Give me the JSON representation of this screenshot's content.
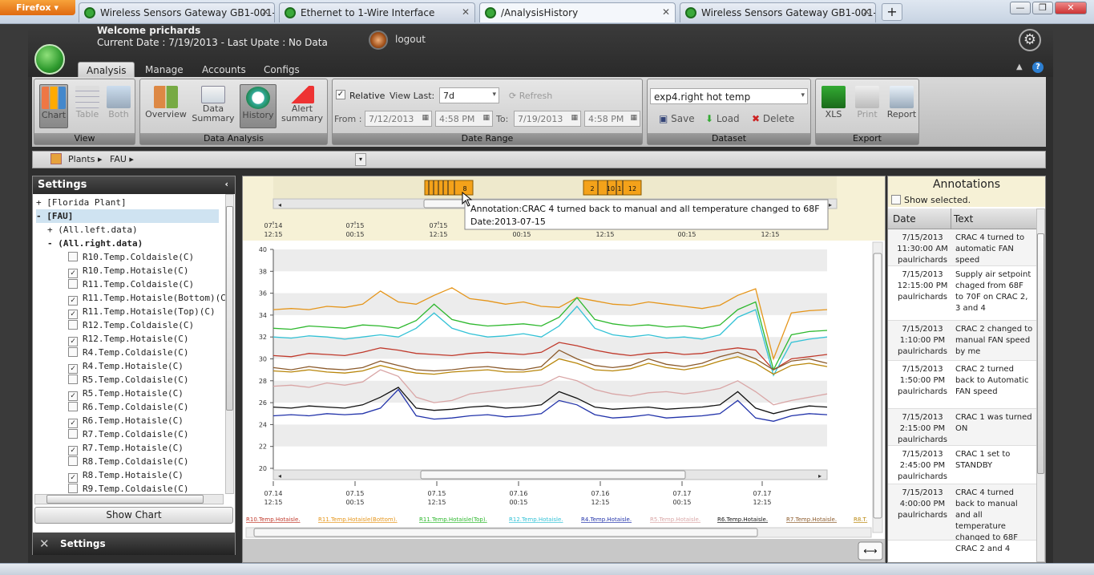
{
  "browser": {
    "app_button": "Firefox",
    "tabs": [
      {
        "title": "Wireless Sensors Gateway GB1-001-20..."
      },
      {
        "title": "Ethernet to 1-Wire Interface"
      },
      {
        "title": "/AnalysisHistory"
      },
      {
        "title": "Wireless Sensors Gateway GB1-001-20..."
      }
    ],
    "new_tab": "+",
    "win_min": "—",
    "win_max": "❐",
    "win_close": "✕"
  },
  "header": {
    "welcome": "Welcome prichards",
    "current_date": "Current Date : 7/19/2013 - Last Upate : No Data",
    "logout": "logout",
    "gear": "⚙"
  },
  "main_tabs": [
    "Analysis",
    "Manage",
    "Accounts",
    "Configs"
  ],
  "ribbon": {
    "view": {
      "label": "View",
      "buttons": [
        "Chart",
        "Table",
        "Both"
      ]
    },
    "data_analysis": {
      "label": "Data Analysis",
      "buttons": [
        "Overview",
        "Data\nSummary",
        "History",
        "Alert\nsummary"
      ]
    },
    "date_range": {
      "label": "Date Range",
      "relative": "Relative",
      "view_last_label": "View Last:",
      "view_last": "7d",
      "refresh": "Refresh",
      "from_label": "From :",
      "from_date": "7/12/2013",
      "from_time": "4:58 PM",
      "to_label": "To:",
      "to_date": "7/19/2013",
      "to_time": "4:58 PM"
    },
    "dataset": {
      "label": "Dataset",
      "selected": "exp4.right hot temp",
      "save": "Save",
      "load": "Load",
      "delete": "Delete"
    },
    "export": {
      "label": "Export",
      "buttons": [
        "XLS",
        "Print",
        "Report"
      ]
    }
  },
  "breadcrumb": [
    "Plants",
    "FAU"
  ],
  "settings": {
    "title": "Settings",
    "tree": [
      {
        "t": "+ [Florida Plant]",
        "i": 0,
        "kind": "node"
      },
      {
        "t": "- [FAU]",
        "i": 0,
        "kind": "sel"
      },
      {
        "t": "+ (All.left.data)",
        "i": 1,
        "kind": "node"
      },
      {
        "t": "- (All.right.data)",
        "i": 1,
        "kind": "bold"
      },
      {
        "t": "R10.Temp.Coldaisle(C)",
        "c": false
      },
      {
        "t": "R10.Temp.Hotaisle(C)",
        "c": true
      },
      {
        "t": "R11.Temp.Coldaisle(C)",
        "c": false
      },
      {
        "t": "R11.Temp.Hotaisle(Bottom)(C)",
        "c": true
      },
      {
        "t": "R11.Temp.Hotaisle(Top)(C)",
        "c": true
      },
      {
        "t": "R12.Temp.Coldaisle(C)",
        "c": false
      },
      {
        "t": "R12.Temp.Hotaisle(C)",
        "c": true
      },
      {
        "t": "R4.Temp.Coldaisle(C)",
        "c": false
      },
      {
        "t": "R4.Temp.Hotaisle(C)",
        "c": true
      },
      {
        "t": "R5.Temp.Coldaisle(C)",
        "c": false
      },
      {
        "t": "R5.Temp.Hotaisle(C)",
        "c": true
      },
      {
        "t": "R6.Temp.Coldaisle(C)",
        "c": false
      },
      {
        "t": "R6.Temp.Hotaisle(C)",
        "c": true
      },
      {
        "t": "R7.Temp.Coldaisle(C)",
        "c": false
      },
      {
        "t": "R7.Temp.Hotaisle(C)",
        "c": true
      },
      {
        "t": "R8.Temp.Coldaisle(C)",
        "c": false
      },
      {
        "t": "R8.Temp.Hotaisle(C)",
        "c": true
      },
      {
        "t": "R9.Temp.Coldaisle(C)",
        "c": false
      }
    ],
    "show_chart": "Show Chart",
    "footer": "Settings"
  },
  "chart_data": {
    "type": "line",
    "tooltip": {
      "line1": "Annotation:CRAC 4 turned back to manual and all temperature changed to 68F",
      "line2": "Date:2013-07-15"
    },
    "markers": [
      "8",
      "2",
      "10",
      "1",
      "12"
    ],
    "nav_ticks": [
      [
        "07.14",
        "12:15"
      ],
      [
        "07.15",
        "00:15"
      ],
      [
        "07.15",
        "12:15"
      ],
      [
        "",
        "00:15"
      ],
      [
        "",
        "12:15"
      ],
      [
        "",
        "00:15"
      ],
      [
        "",
        "12:15"
      ]
    ],
    "x_ticks": [
      [
        "07.14",
        "12:15"
      ],
      [
        "07.15",
        "00:15"
      ],
      [
        "07.15",
        "12:15"
      ],
      [
        "07.16",
        "00:15"
      ],
      [
        "07.16",
        "12:15"
      ],
      [
        "07.17",
        "00:15"
      ],
      [
        "07.17",
        "12:15"
      ]
    ],
    "ylim": [
      20,
      40
    ],
    "y_ticks": [
      20,
      22,
      24,
      26,
      28,
      30,
      32,
      34,
      36,
      38,
      40
    ],
    "series": [
      {
        "name": "R10.Temp.Hotaisle",
        "color": "#c0392b",
        "values": [
          30.3,
          30.2,
          30.5,
          30.4,
          30.3,
          30.6,
          31.0,
          30.8,
          30.5,
          30.4,
          30.3,
          30.5,
          30.6,
          30.5,
          30.4,
          30.6,
          31.5,
          31.2,
          30.8,
          30.5,
          30.3,
          30.5,
          30.6,
          30.4,
          30.5,
          30.8,
          31.0,
          30.8,
          29.0,
          30.0,
          30.2,
          30.4
        ]
      },
      {
        "name": "R11.Temp.Hotaisle(Bottom)",
        "color": "#e5951a",
        "values": [
          34.5,
          34.6,
          34.5,
          34.8,
          34.7,
          35.0,
          36.2,
          35.2,
          35.0,
          35.8,
          36.5,
          35.5,
          35.3,
          35.0,
          35.2,
          34.8,
          34.7,
          35.6,
          35.3,
          35.0,
          34.9,
          35.2,
          35.0,
          34.8,
          34.6,
          34.9,
          35.8,
          36.4,
          30.0,
          34.2,
          34.4,
          34.5
        ]
      },
      {
        "name": "R11.Temp.Hotaisle(Top)",
        "color": "#2eb82e",
        "values": [
          32.8,
          32.7,
          33.0,
          32.9,
          32.8,
          33.1,
          33.0,
          32.8,
          33.5,
          35.0,
          33.6,
          33.2,
          33.0,
          33.1,
          33.2,
          33.0,
          33.8,
          35.6,
          33.6,
          33.2,
          33.0,
          33.1,
          32.9,
          33.0,
          32.8,
          33.1,
          34.5,
          35.2,
          29.0,
          32.2,
          32.5,
          32.6
        ]
      },
      {
        "name": "R12.Temp.Hotaisle",
        "color": "#33c2d6",
        "values": [
          32.0,
          31.9,
          32.1,
          32.0,
          31.8,
          32.0,
          32.2,
          32.0,
          32.8,
          34.2,
          32.8,
          32.3,
          32.0,
          32.1,
          32.3,
          32.0,
          33.0,
          34.8,
          32.8,
          32.2,
          32.0,
          32.2,
          31.9,
          32.0,
          31.8,
          32.2,
          33.8,
          34.5,
          28.5,
          31.5,
          31.8,
          32.0
        ]
      },
      {
        "name": "R4.Temp.Hotaisle",
        "color": "#2233aa",
        "values": [
          24.8,
          24.9,
          24.8,
          25.0,
          24.9,
          25.0,
          25.5,
          27.2,
          24.8,
          24.5,
          24.6,
          24.8,
          24.9,
          24.7,
          24.8,
          25.0,
          26.2,
          25.8,
          24.9,
          24.6,
          24.7,
          24.9,
          24.6,
          24.7,
          24.8,
          25.0,
          26.2,
          24.6,
          24.3,
          24.8,
          25.0,
          24.9
        ]
      },
      {
        "name": "R5.Temp.Hotaisle",
        "color": "#d9a6a6",
        "values": [
          27.5,
          27.6,
          27.4,
          27.8,
          27.6,
          27.9,
          29.0,
          28.4,
          26.5,
          26.0,
          26.2,
          26.8,
          27.0,
          27.2,
          27.4,
          27.6,
          28.4,
          28.0,
          27.2,
          26.8,
          26.6,
          26.9,
          27.0,
          26.8,
          27.0,
          27.3,
          28.0,
          27.0,
          25.8,
          26.2,
          26.5,
          26.8
        ]
      },
      {
        "name": "R6.Temp.Hotaisle",
        "color": "#111111",
        "values": [
          25.6,
          25.5,
          25.7,
          25.6,
          25.5,
          25.8,
          26.5,
          27.4,
          25.5,
          25.3,
          25.4,
          25.6,
          25.7,
          25.5,
          25.6,
          25.8,
          27.0,
          26.4,
          25.6,
          25.4,
          25.5,
          25.6,
          25.4,
          25.5,
          25.6,
          25.8,
          27.0,
          25.5,
          25.0,
          25.4,
          25.7,
          25.6
        ]
      },
      {
        "name": "R7.Temp.Hotaisle",
        "color": "#8b5a2b",
        "values": [
          29.2,
          29.0,
          29.3,
          29.1,
          29.0,
          29.2,
          29.8,
          29.4,
          29.0,
          28.9,
          29.0,
          29.2,
          29.3,
          29.1,
          29.0,
          29.3,
          30.8,
          30.0,
          29.4,
          29.2,
          29.4,
          30.0,
          29.5,
          29.3,
          29.6,
          30.2,
          30.6,
          30.0,
          29.0,
          29.8,
          30.0,
          29.6
        ]
      },
      {
        "name": "R8.T",
        "color": "#b8860b",
        "values": [
          28.9,
          28.8,
          29.0,
          28.8,
          28.7,
          28.9,
          29.4,
          29.0,
          28.7,
          28.6,
          28.8,
          28.9,
          29.0,
          28.8,
          28.8,
          29.0,
          30.0,
          29.6,
          29.0,
          28.9,
          29.1,
          29.6,
          29.2,
          29.0,
          29.3,
          29.8,
          30.2,
          29.6,
          28.6,
          29.4,
          29.6,
          29.3
        ]
      }
    ]
  },
  "annotations": {
    "title": "Annotations",
    "show_selected": "Show selected.",
    "col_date": "Date",
    "col_text": "Text",
    "rows": [
      {
        "d": "7/15/2013",
        "t": "11:30:00 AM",
        "u": "paulrichards",
        "text": "CRAC 4 turned to automatic FAN speed"
      },
      {
        "d": "7/15/2013",
        "t": "12:15:00 PM",
        "u": "paulrichards",
        "text": "Supply air setpoint chaged from 68F to 70F on CRAC 2, 3 and 4"
      },
      {
        "d": "7/15/2013",
        "t": "1:10:00 PM",
        "u": "paulrichards",
        "text": "CRAC 2 changed to manual FAN speed by me"
      },
      {
        "d": "7/15/2013",
        "t": "1:50:00 PM",
        "u": "paulrichards",
        "text": "CRAC 2 turned back to Automatic FAN speed"
      },
      {
        "d": "7/15/2013",
        "t": "2:15:00 PM",
        "u": "paulrichards",
        "text": "CRAC 1 was turned ON"
      },
      {
        "d": "7/15/2013",
        "t": "2:45:00 PM",
        "u": "paulrichards",
        "text": "CRAC 1 set to STANDBY"
      },
      {
        "d": "7/15/2013",
        "t": "4:00:00 PM",
        "u": "paulrichards",
        "text": "CRAC 4 turned back to manual and all temperature changed to 68F"
      },
      {
        "d": "",
        "t": "",
        "u": "",
        "text": "CRAC 2 and 4"
      }
    ]
  }
}
